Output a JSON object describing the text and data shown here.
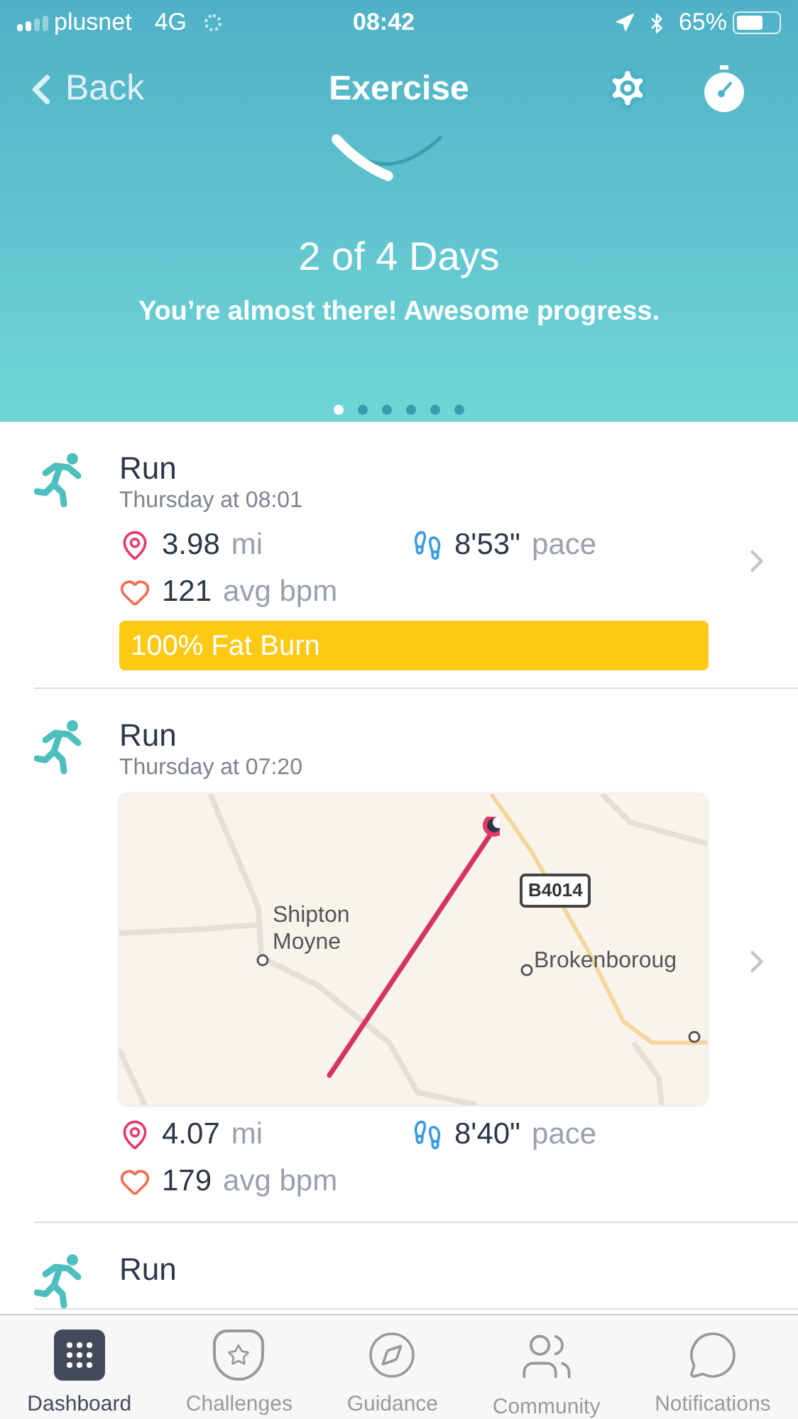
{
  "status_bar": {
    "carrier": "plusnet",
    "network": "4G",
    "time": "08:42",
    "battery": "65%"
  },
  "nav": {
    "back": "Back",
    "title": "Exercise"
  },
  "goal": {
    "level": 0.5,
    "headline": "2 of 4 Days",
    "message": "You’re almost there! Awesome progress."
  },
  "pages": [
    {
      "selected": true
    },
    {
      "selected": false
    },
    {
      "selected": false
    },
    {
      "selected": false
    },
    {
      "selected": false
    },
    {
      "selected": false
    }
  ],
  "activities": [
    {
      "kind": "zone",
      "title": "Run",
      "time": "Thursday at 08:01",
      "distance": "3.98",
      "distance_unit": "mi",
      "pace": "8'53\"",
      "pace_unit": "pace",
      "heart": "121",
      "heart_unit": "avg bpm",
      "zone": "100% Fat Burn"
    },
    {
      "kind": "map",
      "title": "Run",
      "time": "Thursday at 07:20",
      "map_labels": [
        "Shipton Moyne",
        "B4014",
        "Brokenboroug"
      ],
      "distance": "4.07",
      "distance_unit": "mi",
      "pace": "8'40\"",
      "pace_unit": "pace",
      "heart": "179",
      "heart_unit": "avg bpm"
    },
    {
      "kind": "cut",
      "title": "Run"
    }
  ],
  "tabs": [
    {
      "label": "Dashboard",
      "selected": true
    },
    {
      "label": "Challenges",
      "selected": false
    },
    {
      "label": "Guidance",
      "selected": false
    },
    {
      "label": "Community",
      "selected": false
    },
    {
      "label": "Notifications",
      "selected": false
    }
  ]
}
